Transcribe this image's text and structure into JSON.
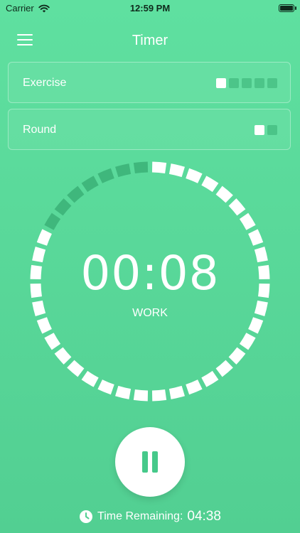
{
  "status_bar": {
    "carrier": "Carrier",
    "time": "12:59 PM"
  },
  "nav": {
    "title": "Timer",
    "menu_icon": "hamburger-menu-icon"
  },
  "exercise": {
    "label": "Exercise",
    "total": 5,
    "current": 1
  },
  "round": {
    "label": "Round",
    "total": 2,
    "current": 1
  },
  "timer": {
    "time": "00:08",
    "phase": "WORK",
    "progress_fraction": 0.82,
    "segments": 40
  },
  "controls": {
    "pause_icon": "pause-icon"
  },
  "footer": {
    "remaining_label": "Time Remaining:",
    "remaining_value": "04:38",
    "icon": "clock-icon"
  },
  "colors": {
    "background": "#5fe0a0",
    "accent": "#46c98a",
    "segment_active": "#ffffff",
    "segment_inactive": "#3fb77c"
  }
}
